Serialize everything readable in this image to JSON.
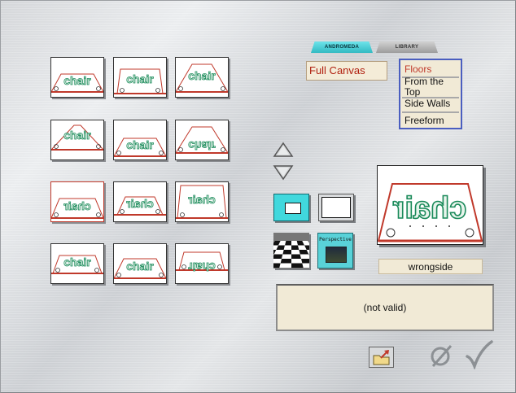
{
  "tabs": {
    "andromeda": "ANDROMEDA",
    "library": "LIBRARY"
  },
  "canvas_mode": "Full Canvas",
  "menu": {
    "items": [
      "Floors",
      "From the Top",
      "Side Walls",
      "Freeform"
    ],
    "selected_index": 0,
    "colors": {
      "selected": "#c0392b",
      "normal": "#111111",
      "border": "#4a5ec0"
    }
  },
  "thumbnails": {
    "text": "chair",
    "selected_index": 6
  },
  "buttons": {
    "perspective_label": "Perspective"
  },
  "preview": {
    "name": "wrongside"
  },
  "status": "(not valid)",
  "icons": {
    "up": "triangle-up-icon",
    "down": "triangle-down-icon",
    "folder": "folder-arrow-icon",
    "cancel": "cancel-slash-icon",
    "ok": "checkmark-icon"
  },
  "colors": {
    "accent_cyan": "#41d8dd",
    "panel_cream": "#f1ead6",
    "floor_green": "#1a8a5a",
    "red": "#c0392b"
  }
}
